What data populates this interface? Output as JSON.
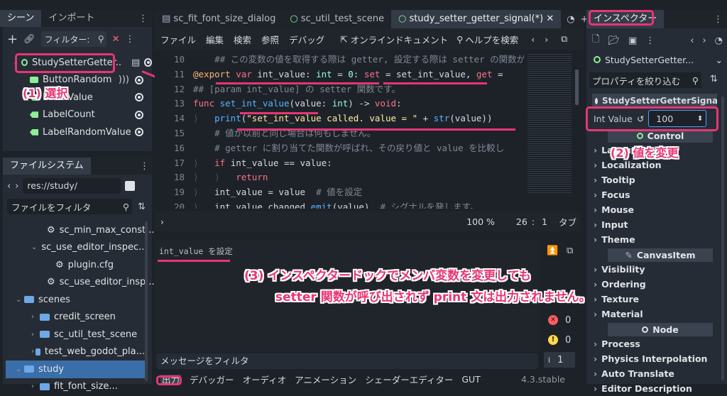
{
  "scene_dock": {
    "tabs": [
      "シーン",
      "インポート"
    ],
    "filter_placeholder": "フィルター:",
    "nodes": [
      {
        "label": "StudySetterGetter..",
        "type": "root"
      },
      {
        "label": "ButtonRandom",
        "type": "button"
      },
      {
        "label": "LabelValue",
        "type": "label"
      },
      {
        "label": "LabelCount",
        "type": "label"
      },
      {
        "label": "LabelRandomValue",
        "type": "label"
      }
    ]
  },
  "filesystem": {
    "title": "ファイルシステム",
    "path": "res://study/",
    "filter_placeholder": "ファイルをフィルタ",
    "items": [
      {
        "label": "sc_min_max_const...",
        "kind": "gear",
        "indent": 2
      },
      {
        "label": "sc_use_editor_inspec...",
        "kind": "folder-open",
        "indent": 1
      },
      {
        "label": "plugin.cfg",
        "kind": "gear",
        "indent": 2
      },
      {
        "label": "sc_use_editor_insp...",
        "kind": "gear",
        "indent": 2
      },
      {
        "label": "scenes",
        "kind": "folder-open",
        "indent": 0
      },
      {
        "label": "credit_screen",
        "kind": "folder",
        "indent": 1
      },
      {
        "label": "sc_util_test_scene",
        "kind": "folder",
        "indent": 1
      },
      {
        "label": "test_web_godot_pla...",
        "kind": "folder",
        "indent": 1
      },
      {
        "label": "study",
        "kind": "folder-open",
        "indent": 0
      },
      {
        "label": "fit_font_size...",
        "kind": "folder",
        "indent": 1
      }
    ]
  },
  "editor": {
    "tabs": [
      "sc_fit_font_size_dialog",
      "sc_util_test_scene",
      "study_setter_getter_signal(*)"
    ],
    "menu": [
      "ファイル",
      "編集",
      "検索",
      "参照",
      "デバッグ"
    ],
    "online_docs": "オンラインドキュメント",
    "help_search": "ヘルプを検索",
    "lines": [
      {
        "n": "10",
        "text": "    ## この変数の値を取得する際は getter, 設定する際は setter の関数が"
      },
      {
        "n": "11",
        "text": "@export var int_value: int = 0: set = set_int_value, get ="
      },
      {
        "n": "12",
        "text": "## [param int_value] の setter 関数です。"
      },
      {
        "n": "13",
        "text": "func set_int_value(value: int) -> void:"
      },
      {
        "n": "14",
        "text": "    print(\"set_int_value called. value = \" + str(value))"
      },
      {
        "n": "15",
        "text": "    # 値が以前と同じ場合は何もしません。"
      },
      {
        "n": "16",
        "text": "    # getter に割り当てた関数が呼ばれ、その戻り値と value を比較し"
      },
      {
        "n": "17",
        "text": "    if int_value == value:"
      },
      {
        "n": "18",
        "text": "        return"
      },
      {
        "n": "19",
        "text": "    int_value = value  # 値を設定"
      },
      {
        "n": "20",
        "text": "    int_value_changed.emit(value)  # シグナルを発します。"
      }
    ],
    "zoom": "100 %",
    "line_status": "26",
    "col_status": "1",
    "indent_mode": "タブ"
  },
  "output": {
    "text": "int_value を設定",
    "filter_placeholder": "メッセージをフィルタ",
    "error_count": "0",
    "warning_count": "0",
    "message_count": "1",
    "bottom_tabs": [
      "出力",
      "デバッガー",
      "オーディオ",
      "アニメーション",
      "シェーダーエディター",
      "GUT"
    ],
    "version": "4.3.stable"
  },
  "inspector": {
    "title": "インスペクター",
    "node_selector": "StudySetterGetter...",
    "filter_placeholder": "プロパティを絞り込む",
    "script_header": "StudySetterGetterSignal",
    "int_value_label": "Int Value",
    "int_value": "100",
    "control_header": "Control",
    "control_groups": [
      "Layout",
      "Localization",
      "Tooltip",
      "Focus",
      "Mouse",
      "Input",
      "Theme"
    ],
    "canvas_header": "CanvasItem",
    "canvas_groups": [
      "Visibility",
      "Ordering",
      "Texture",
      "Material"
    ],
    "node_header": "Node",
    "node_groups": [
      "Process",
      "Physics Interpolation",
      "Auto Translate",
      "Editor Description"
    ]
  },
  "annotations": {
    "step1": "(1) 選択",
    "step2": "(2) 値を変更",
    "step3_line1": "(3) インスペクタードックでメンバ変数を変更しても",
    "step3_line2": "setter 関数が呼び出されず print 文は出力されません。"
  },
  "colors": {
    "annotation": "#e83574",
    "accent": "#4aa3ff",
    "root_node_icon": "#8eef97"
  }
}
